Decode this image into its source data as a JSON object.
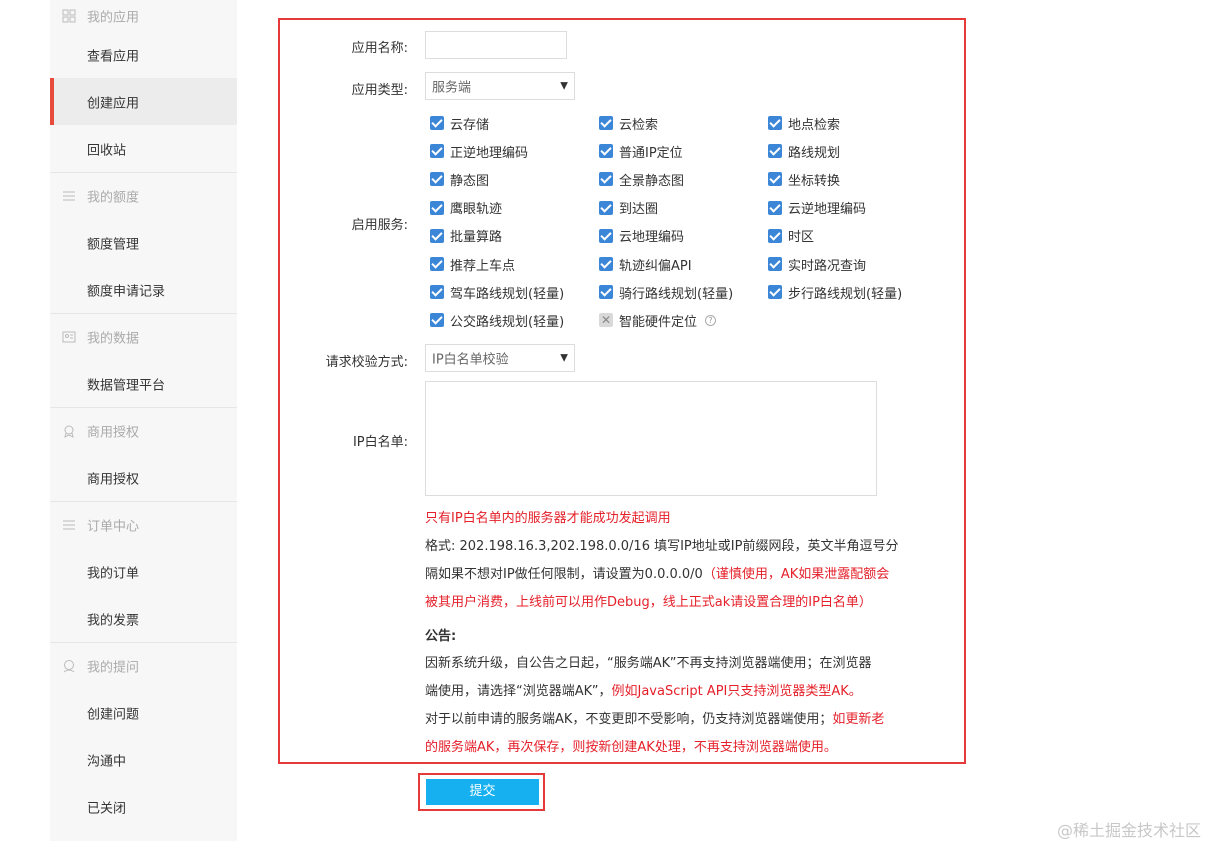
{
  "sidebar": {
    "groups": [
      {
        "label": "我的应用",
        "icon": "grid-icon"
      },
      {
        "label": "我的额度",
        "icon": "list-icon"
      },
      {
        "label": "我的数据",
        "icon": "id-card-icon"
      },
      {
        "label": "商用授权",
        "icon": "badge-icon"
      },
      {
        "label": "订单中心",
        "icon": "list-icon"
      },
      {
        "label": "我的提问",
        "icon": "support-icon"
      }
    ],
    "items": {
      "view_app": "查看应用",
      "create_app": "创建应用",
      "recycle": "回收站",
      "quota_manage": "额度管理",
      "quota_record": "额度申请记录",
      "data_platform": "数据管理平台",
      "commercial": "商用授权",
      "my_orders": "我的订单",
      "my_invoices": "我的发票",
      "create_question": "创建问题",
      "communicating": "沟通中",
      "closed": "已关闭"
    }
  },
  "form": {
    "app_name_label": "应用名称:",
    "app_name_value": "",
    "app_type_label": "应用类型:",
    "app_type_value": "服务端",
    "services_label": "启用服务:",
    "services": [
      {
        "label": "云存储",
        "checked": true
      },
      {
        "label": "云检索",
        "checked": true
      },
      {
        "label": "地点检索",
        "checked": true
      },
      {
        "label": "正逆地理编码",
        "checked": true
      },
      {
        "label": "普通IP定位",
        "checked": true
      },
      {
        "label": "路线规划",
        "checked": true
      },
      {
        "label": "静态图",
        "checked": true
      },
      {
        "label": "全景静态图",
        "checked": true
      },
      {
        "label": "坐标转换",
        "checked": true
      },
      {
        "label": "鹰眼轨迹",
        "checked": true
      },
      {
        "label": "到达圈",
        "checked": true
      },
      {
        "label": "云逆地理编码",
        "checked": true
      },
      {
        "label": "批量算路",
        "checked": true
      },
      {
        "label": "云地理编码",
        "checked": true
      },
      {
        "label": "时区",
        "checked": true
      },
      {
        "label": "推荐上车点",
        "checked": true
      },
      {
        "label": "轨迹纠偏API",
        "checked": true
      },
      {
        "label": "实时路况查询",
        "checked": true
      },
      {
        "label": "驾车路线规划(轻量)",
        "checked": true
      },
      {
        "label": "骑行路线规划(轻量)",
        "checked": true
      },
      {
        "label": "步行路线规划(轻量)",
        "checked": true
      },
      {
        "label": "公交路线规划(轻量)",
        "checked": true
      },
      {
        "label": "智能硬件定位",
        "checked": false
      }
    ],
    "help_glyph": "?",
    "verify_label": "请求校验方式:",
    "verify_value": "IP白名单校验",
    "whitelist_label": "IP白名单:",
    "whitelist_value": "",
    "notice_red": "只有IP白名单内的服务器才能成功发起调用",
    "format_line1": "格式: 202.198.16.3,202.198.0.0/16 填写IP地址或IP前缀网段，英文半角逗号分",
    "format_line2_dark": "隔如果不想对IP做任何限制，请设置为0.0.0.0/0",
    "format_line2_red": "（谨慎使用，AK如果泄露配额会",
    "format_line3_red": "被其用户消费，上线前可以用作Debug，线上正式ak请设置合理的IP白名单）",
    "announce_title": "公告:",
    "announce_line1": "因新系统升级，自公告之日起，“服务端AK”不再支持浏览器端使用；在浏览器",
    "announce_line2_dark": "端使用，请选择“浏览器端AK”，",
    "announce_line2_red": "例如JavaScript API只支持浏览器类型AK。",
    "announce_line3_dark": "对于以前申请的服务端AK，不变更即不受影响，仍支持浏览器端使用；",
    "announce_line3_red": "如更新老",
    "announce_line4_red": "的服务端AK，再次保存，则按新创建AK处理，不再支持浏览器端使用。",
    "submit_label": "提交",
    "caret": "▼"
  },
  "watermark": "@稀土掘金技术社区",
  "colors": {
    "accent_red": "#e5393a",
    "checkbox_blue": "#3b86d6",
    "submit_blue": "#16b0f0",
    "notice_red": "#e5202a"
  }
}
